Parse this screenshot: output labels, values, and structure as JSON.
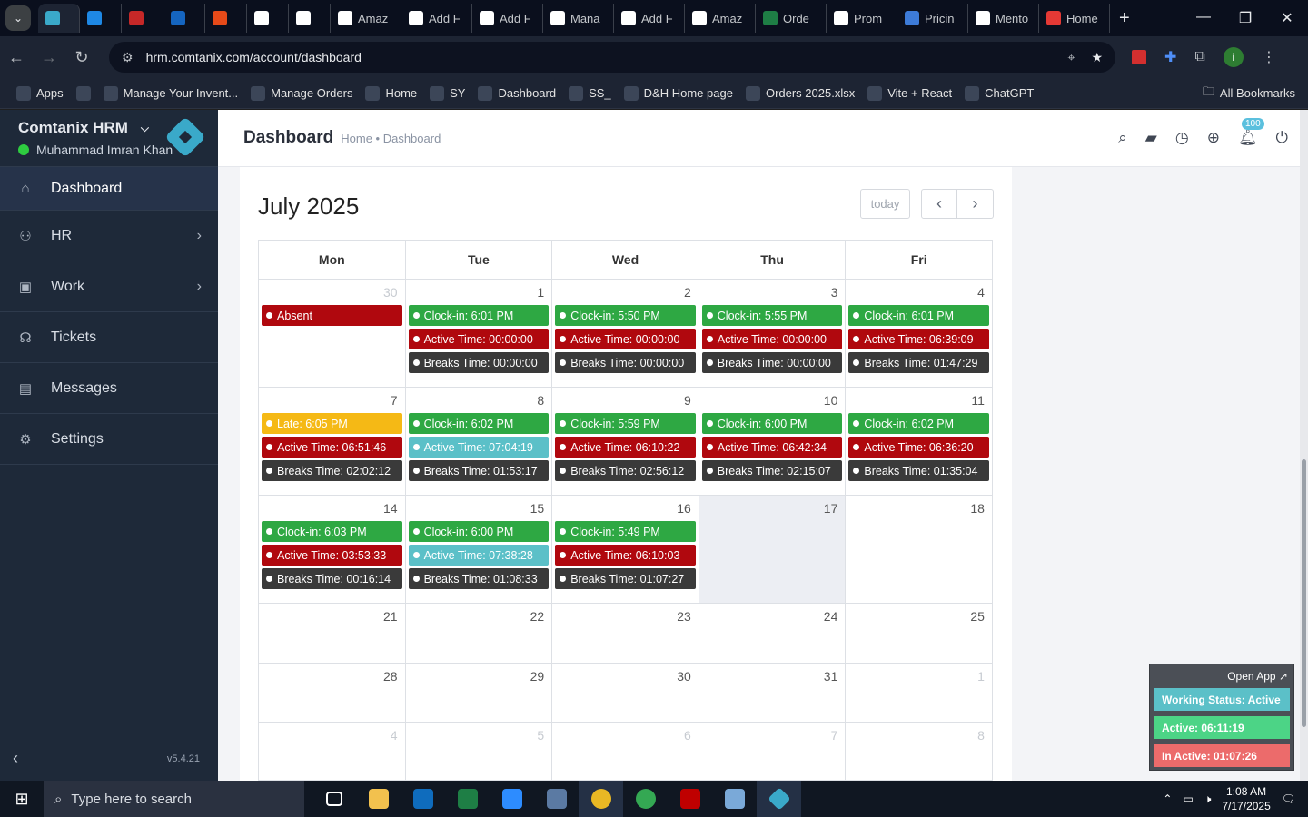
{
  "browser": {
    "tabs": [
      {
        "label": "",
        "icon": "comtanix-icon",
        "color": "#3aa9c9",
        "active": true
      },
      {
        "label": "",
        "icon": "ec-icon",
        "color": "#1e88e5"
      },
      {
        "label": "",
        "icon": "dh-icon",
        "color": "#c62828"
      },
      {
        "label": "",
        "icon": "g-icon",
        "color": "#1565c0"
      },
      {
        "label": "",
        "icon": "ss-icon",
        "color": "#e64a19"
      },
      {
        "label": "",
        "icon": "amazon-icon",
        "color": "#ffffff"
      },
      {
        "label": "",
        "icon": "amazon-icon",
        "color": "#ffffff"
      },
      {
        "label": "Amaz",
        "icon": "amazon-icon",
        "color": "#ffffff"
      },
      {
        "label": "Add F",
        "icon": "amazon-icon",
        "color": "#ffffff"
      },
      {
        "label": "Add F",
        "icon": "amazon-icon",
        "color": "#ffffff"
      },
      {
        "label": "Mana",
        "icon": "amazon-icon",
        "color": "#ffffff"
      },
      {
        "label": "Add F",
        "icon": "amazon-icon",
        "color": "#ffffff"
      },
      {
        "label": "Amaz",
        "icon": "amazon-icon",
        "color": "#ffffff"
      },
      {
        "label": "Orde",
        "icon": "excel-icon",
        "color": "#1e7e45"
      },
      {
        "label": "Prom",
        "icon": "openai-icon",
        "color": "#ffffff"
      },
      {
        "label": "Pricin",
        "icon": "dollar-icon",
        "color": "#3d7bd8"
      },
      {
        "label": "Mento",
        "icon": "openai-icon",
        "color": "#ffffff"
      },
      {
        "label": "Home",
        "icon": "home-icon",
        "color": "#e53935"
      }
    ],
    "url": "hrm.comtanix.com/account/dashboard",
    "bookmarks": [
      {
        "label": "Apps",
        "icon": "apps-icon"
      },
      {
        "label": "",
        "icon": "grid-icon"
      },
      {
        "label": "Manage Your Invent...",
        "icon": "amazon-icon"
      },
      {
        "label": "Manage Orders",
        "icon": "amazon-icon"
      },
      {
        "label": "Home",
        "icon": "g-icon"
      },
      {
        "label": "SY",
        "icon": "ec-icon"
      },
      {
        "label": "Dashboard",
        "icon": "comtanix-icon"
      },
      {
        "label": "SS_",
        "icon": "ss-icon"
      },
      {
        "label": "D&H Home page",
        "icon": "dh-icon"
      },
      {
        "label": "Orders 2025.xlsx",
        "icon": "excel-icon"
      },
      {
        "label": "Vite + React",
        "icon": "dollar-icon"
      },
      {
        "label": "ChatGPT",
        "icon": "openai-icon"
      }
    ],
    "all_bookmarks": "All Bookmarks"
  },
  "app": {
    "brand": "Comtanix HRM",
    "user": "Muhammad Imran Khan",
    "nav": [
      {
        "label": "Dashboard",
        "icon": "home-icon",
        "active": true,
        "chevron": false
      },
      {
        "label": "HR",
        "icon": "users-icon",
        "chevron": true
      },
      {
        "label": "Work",
        "icon": "briefcase-icon",
        "chevron": true
      },
      {
        "label": "Tickets",
        "icon": "headset-icon",
        "chevron": false
      },
      {
        "label": "Messages",
        "icon": "message-icon",
        "chevron": false
      },
      {
        "label": "Settings",
        "icon": "gear-icon",
        "chevron": false
      }
    ],
    "version": "v5.4.21",
    "page_title": "Dashboard",
    "breadcrumb": "Home • Dashboard",
    "notification_count": "100"
  },
  "calendar": {
    "title": "July 2025",
    "today_label": "today",
    "days_of_week": [
      "Mon",
      "Tue",
      "Wed",
      "Thu",
      "Fri"
    ],
    "colors": {
      "green": "#2ea843",
      "red": "#b0080e",
      "dark": "#3a3a3a",
      "yellow": "#f5b915",
      "teal": "#5bc0c8"
    },
    "weeks": [
      [
        {
          "num": "30",
          "other": true,
          "events": [
            {
              "text": "Absent",
              "color": "red"
            }
          ]
        },
        {
          "num": "1",
          "events": [
            {
              "text": "Clock-in: 6:01 PM",
              "color": "green"
            },
            {
              "text": "Active Time: 00:00:00",
              "color": "red"
            },
            {
              "text": "Breaks Time: 00:00:00",
              "color": "dark"
            }
          ]
        },
        {
          "num": "2",
          "events": [
            {
              "text": "Clock-in: 5:50 PM",
              "color": "green"
            },
            {
              "text": "Active Time: 00:00:00",
              "color": "red"
            },
            {
              "text": "Breaks Time: 00:00:00",
              "color": "dark"
            }
          ]
        },
        {
          "num": "3",
          "events": [
            {
              "text": "Clock-in: 5:55 PM",
              "color": "green"
            },
            {
              "text": "Active Time: 00:00:00",
              "color": "red"
            },
            {
              "text": "Breaks Time: 00:00:00",
              "color": "dark"
            }
          ]
        },
        {
          "num": "4",
          "events": [
            {
              "text": "Clock-in: 6:01 PM",
              "color": "green"
            },
            {
              "text": "Active Time: 06:39:09",
              "color": "red"
            },
            {
              "text": "Breaks Time: 01:47:29",
              "color": "dark"
            }
          ]
        }
      ],
      [
        {
          "num": "7",
          "events": [
            {
              "text": "Late: 6:05 PM",
              "color": "yellow"
            },
            {
              "text": "Active Time: 06:51:46",
              "color": "red"
            },
            {
              "text": "Breaks Time: 02:02:12",
              "color": "dark"
            }
          ]
        },
        {
          "num": "8",
          "events": [
            {
              "text": "Clock-in: 6:02 PM",
              "color": "green"
            },
            {
              "text": "Active Time: 07:04:19",
              "color": "teal"
            },
            {
              "text": "Breaks Time: 01:53:17",
              "color": "dark"
            }
          ]
        },
        {
          "num": "9",
          "events": [
            {
              "text": "Clock-in: 5:59 PM",
              "color": "green"
            },
            {
              "text": "Active Time: 06:10:22",
              "color": "red"
            },
            {
              "text": "Breaks Time: 02:56:12",
              "color": "dark"
            }
          ]
        },
        {
          "num": "10",
          "events": [
            {
              "text": "Clock-in: 6:00 PM",
              "color": "green"
            },
            {
              "text": "Active Time: 06:42:34",
              "color": "red"
            },
            {
              "text": "Breaks Time: 02:15:07",
              "color": "dark"
            }
          ]
        },
        {
          "num": "11",
          "events": [
            {
              "text": "Clock-in: 6:02 PM",
              "color": "green"
            },
            {
              "text": "Active Time: 06:36:20",
              "color": "red"
            },
            {
              "text": "Breaks Time: 01:35:04",
              "color": "dark"
            }
          ]
        }
      ],
      [
        {
          "num": "14",
          "events": [
            {
              "text": "Clock-in: 6:03 PM",
              "color": "green"
            },
            {
              "text": "Active Time: 03:53:33",
              "color": "red"
            },
            {
              "text": "Breaks Time: 00:16:14",
              "color": "dark"
            }
          ]
        },
        {
          "num": "15",
          "events": [
            {
              "text": "Clock-in: 6:00 PM",
              "color": "green"
            },
            {
              "text": "Active Time: 07:38:28",
              "color": "teal"
            },
            {
              "text": "Breaks Time: 01:08:33",
              "color": "dark"
            }
          ]
        },
        {
          "num": "16",
          "events": [
            {
              "text": "Clock-in: 5:49 PM",
              "color": "green"
            },
            {
              "text": "Active Time: 06:10:03",
              "color": "red"
            },
            {
              "text": "Breaks Time: 01:07:27",
              "color": "dark"
            }
          ]
        },
        {
          "num": "17",
          "today": true,
          "events": []
        },
        {
          "num": "18",
          "events": []
        }
      ],
      [
        {
          "num": "21",
          "events": []
        },
        {
          "num": "22",
          "events": []
        },
        {
          "num": "23",
          "events": []
        },
        {
          "num": "24",
          "events": []
        },
        {
          "num": "25",
          "events": []
        }
      ],
      [
        {
          "num": "28",
          "events": []
        },
        {
          "num": "29",
          "events": []
        },
        {
          "num": "30",
          "events": []
        },
        {
          "num": "31",
          "events": []
        },
        {
          "num": "1",
          "other": true,
          "events": []
        }
      ],
      [
        {
          "num": "4",
          "other": true,
          "events": []
        },
        {
          "num": "5",
          "other": true,
          "events": []
        },
        {
          "num": "6",
          "other": true,
          "events": []
        },
        {
          "num": "7",
          "other": true,
          "events": []
        },
        {
          "num": "8",
          "other": true,
          "events": []
        }
      ]
    ]
  },
  "status_panel": {
    "open_app": "Open App ↗",
    "working_status": "Working Status: Active",
    "active": "Active: 06:11:19",
    "inactive": "In Active: 01:07:26",
    "colors": {
      "status": "#5bc0c8",
      "active": "#4cd486",
      "inactive": "#ec6b6b"
    }
  },
  "taskbar": {
    "search_placeholder": "Type here to search",
    "time": "1:08 AM",
    "date": "7/17/2025",
    "apps": [
      {
        "icon": "task-view-icon",
        "color": "#ffffff"
      },
      {
        "icon": "file-explorer-icon",
        "color": "#f2c14e"
      },
      {
        "icon": "outlook-icon",
        "color": "#0f6cbd"
      },
      {
        "icon": "excel-icon",
        "color": "#1e7e45"
      },
      {
        "icon": "zoom-icon",
        "color": "#2d8cff"
      },
      {
        "icon": "calculator-icon",
        "color": "#5b7aa3"
      },
      {
        "icon": "chrome-icon",
        "color": "#e9b824"
      },
      {
        "icon": "chrome-icon",
        "color": "#34a853"
      },
      {
        "icon": "filezilla-icon",
        "color": "#bf0000"
      },
      {
        "icon": "notepad-icon",
        "color": "#7aa9d8"
      },
      {
        "icon": "comtanix-icon",
        "color": "#3aa9c9"
      }
    ]
  }
}
